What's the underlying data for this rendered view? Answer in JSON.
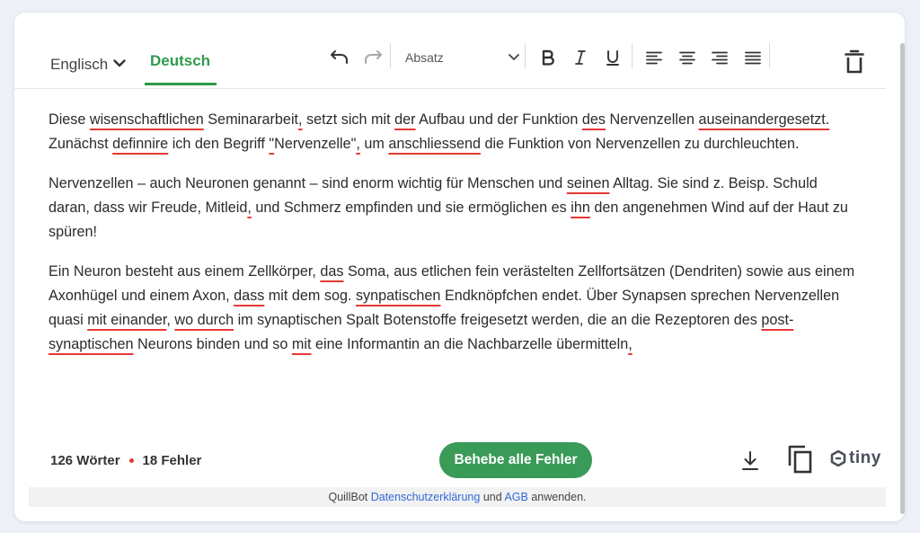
{
  "tabs": {
    "source": "Englisch",
    "target": "Deutsch"
  },
  "toolbar": {
    "paragraph_format": "Absatz"
  },
  "text": {
    "p1": [
      {
        "t": "Diese "
      },
      {
        "t": "wisenschaftlichen",
        "e": true
      },
      {
        "t": " Seminararbeit"
      },
      {
        "t": ",",
        "e": true
      },
      {
        "t": " setzt sich mit "
      },
      {
        "t": "der",
        "e": true
      },
      {
        "t": " Aufbau und der Funktion "
      },
      {
        "t": "des",
        "e": true
      },
      {
        "t": " Nervenzellen "
      },
      {
        "t": "auseinandergesetzt.",
        "e": true
      },
      {
        "t": " Zunächst "
      },
      {
        "t": "definnire",
        "e": true
      },
      {
        "t": " ich den Begriff "
      },
      {
        "t": "\"",
        "e": true
      },
      {
        "t": "Nervenzelle\""
      },
      {
        "t": ",",
        "e": true
      },
      {
        "t": " um "
      },
      {
        "t": "anschliessend",
        "e": true
      },
      {
        "t": " die Funktion von Nervenzellen zu durchleuchten."
      }
    ],
    "p2": [
      {
        "t": "Nervenzellen – auch Neuronen genannt – sind enorm wichtig für Menschen und "
      },
      {
        "t": "seinen",
        "e": true
      },
      {
        "t": " Alltag. Sie sind z. Beisp. Schuld daran, dass wir Freude, Mitleid"
      },
      {
        "t": ",",
        "e": true
      },
      {
        "t": " und Schmerz empfinden und sie ermöglichen es "
      },
      {
        "t": "ihn",
        "e": true
      },
      {
        "t": " den angenehmen Wind auf der Haut zu spüren!"
      }
    ],
    "p3": [
      {
        "t": "Ein Neuron besteht aus einem Zellkörper, "
      },
      {
        "t": "das",
        "e": true
      },
      {
        "t": " Soma, aus etlichen fein verästelten Zellfortsätzen (Dendriten) sowie aus einem Axonhügel und einem Axon, "
      },
      {
        "t": "dass",
        "e": true
      },
      {
        "t": " mit dem sog. "
      },
      {
        "t": "synpatischen",
        "e": true
      },
      {
        "t": " Endknöpfchen endet. Über Synapsen sprechen Nervenzellen quasi "
      },
      {
        "t": "mit einander",
        "e": true
      },
      {
        "t": ", "
      },
      {
        "t": "wo durch",
        "e": true
      },
      {
        "t": " im synaptischen Spalt Botenstoffe freigesetzt werden, die an die Rezeptoren des "
      },
      {
        "t": "post-synaptischen",
        "e": true
      },
      {
        "t": " Neurons binden und so "
      },
      {
        "t": "mit",
        "e": true
      },
      {
        "t": " eine Informantin an die Nachbarzelle übermitteln"
      },
      {
        "t": ",",
        "e": true
      }
    ]
  },
  "footer": {
    "word_count": "126 Wörter",
    "error_count": "18 Fehler",
    "fix_button": "Behebe alle Fehler",
    "brand": "tiny"
  },
  "legal": {
    "prefix": "QuillBot ",
    "privacy": "Datenschutzerklärung",
    "and": " und ",
    "terms": "AGB",
    "suffix": " anwenden."
  },
  "colors": {
    "accent": "#2f9a4c",
    "error": "#e53935",
    "link": "#2e6bd6"
  },
  "icons": [
    "chevron-down-icon",
    "undo-icon",
    "redo-icon",
    "bold-icon",
    "italic-icon",
    "underline-icon",
    "align-left-icon",
    "align-center-icon",
    "align-right-icon",
    "align-justify-icon",
    "trash-icon",
    "download-icon",
    "copy-icon",
    "tiny-logo-icon"
  ]
}
